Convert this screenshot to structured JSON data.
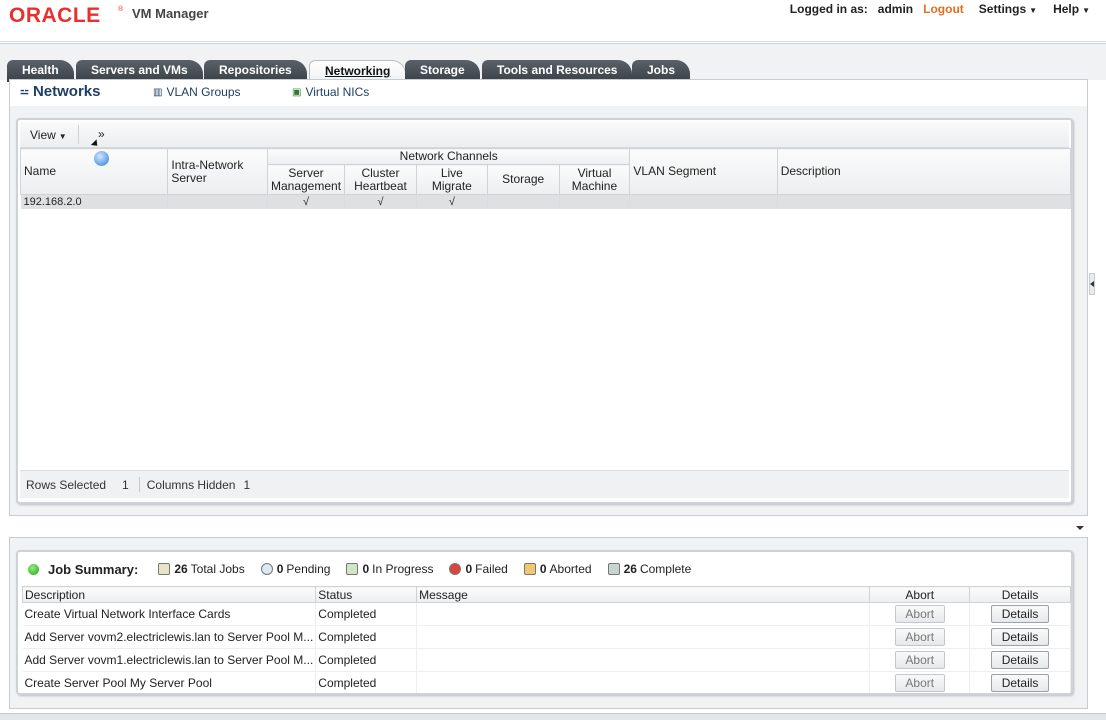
{
  "header": {
    "logo": "ORACLE",
    "product": "VM Manager",
    "logged_in_label": "Logged in as:",
    "username": "admin",
    "logout": "Logout",
    "settings": "Settings",
    "help": "Help"
  },
  "tabs": [
    {
      "label": "Health"
    },
    {
      "label": "Servers and VMs"
    },
    {
      "label": "Repositories"
    },
    {
      "label": "Networking",
      "active": true
    },
    {
      "label": "Storage"
    },
    {
      "label": "Tools and Resources"
    },
    {
      "label": "Jobs"
    }
  ],
  "subnav": {
    "networks": "Networks",
    "vlan_groups": "VLAN Groups",
    "virtual_nics": "Virtual NICs"
  },
  "toolbar": {
    "view": "View",
    "more": "»"
  },
  "networks_table": {
    "columns": {
      "name": "Name",
      "intra_network_server": "Intra-Network Server",
      "network_channels": "Network Channels",
      "server_management": "Server Management",
      "cluster_heartbeat": "Cluster Heartbeat",
      "live_migrate": "Live Migrate",
      "storage": "Storage",
      "virtual_machine": "Virtual Machine",
      "vlan_segment": "VLAN Segment",
      "description": "Description"
    },
    "rows": [
      {
        "name": "192.168.2.0",
        "intra_network_server": "",
        "server_management": "√",
        "cluster_heartbeat": "√",
        "live_migrate": "√",
        "storage": "",
        "virtual_machine": "",
        "vlan_segment": "",
        "description": ""
      }
    ],
    "footer": {
      "rows_selected_label": "Rows Selected",
      "rows_selected": "1",
      "columns_hidden_label": "Columns Hidden",
      "columns_hidden": "1"
    }
  },
  "job_summary": {
    "title": "Job Summary:",
    "stats": {
      "total": {
        "count": "26",
        "label": "Total Jobs",
        "icon": "total-jobs-icon"
      },
      "pending": {
        "count": "0",
        "label": "Pending",
        "icon": "pending-icon"
      },
      "in_progress": {
        "count": "0",
        "label": "In Progress",
        "icon": "in-progress-icon"
      },
      "failed": {
        "count": "0",
        "label": "Failed",
        "icon": "failed-icon"
      },
      "aborted": {
        "count": "0",
        "label": "Aborted",
        "icon": "aborted-icon"
      },
      "complete": {
        "count": "26",
        "label": "Complete",
        "icon": "complete-icon"
      }
    },
    "columns": {
      "description": "Description",
      "status": "Status",
      "message": "Message",
      "abort": "Abort",
      "details": "Details"
    },
    "rows": [
      {
        "description": "Create Virtual Network Interface Cards",
        "status": "Completed",
        "message": "",
        "abort": "Abort",
        "details": "Details"
      },
      {
        "description": "Add Server vovm2.electriclewis.lan to Server Pool M...",
        "status": "Completed",
        "message": "",
        "abort": "Abort",
        "details": "Details"
      },
      {
        "description": "Add Server vovm1.electriclewis.lan to Server Pool M...",
        "status": "Completed",
        "message": "",
        "abort": "Abort",
        "details": "Details"
      },
      {
        "description": "Create Server Pool My Server Pool",
        "status": "Completed",
        "message": "",
        "abort": "Abort",
        "details": "Details"
      }
    ]
  },
  "colors": {
    "oracle_red": "#e8312f",
    "logout_orange": "#e07020",
    "tab_dark": "#3a4046",
    "link_blue": "#1e3f66",
    "ok_green": "#27a11a"
  }
}
